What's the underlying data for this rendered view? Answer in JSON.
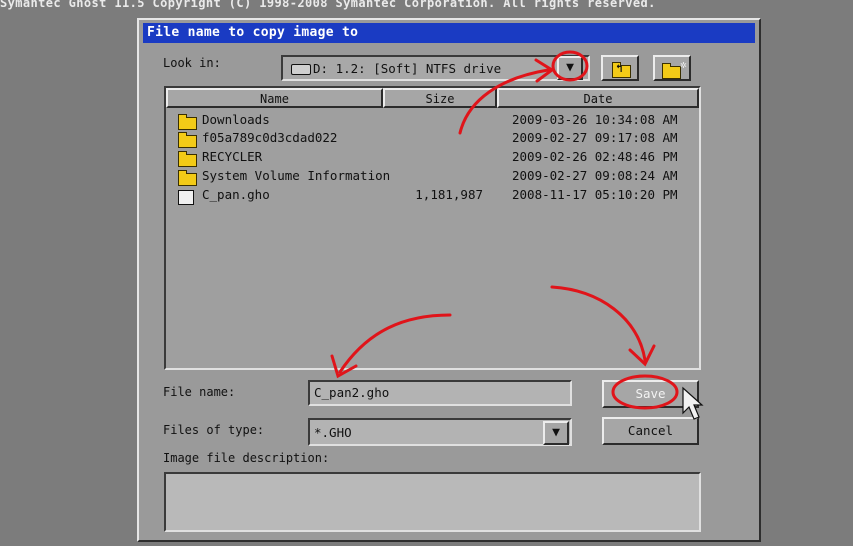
{
  "screen": {
    "top_banner": "Symantec Ghost 11.5   Copyright (C) 1998-2008 Symantec Corporation. All rights reserved."
  },
  "dialog": {
    "title": "File name to copy image to",
    "look_in_label": "Look in:",
    "look_in_value": "D: 1.2: [Soft] NTFS drive",
    "dropdown_glyph": "▼",
    "file_list": {
      "columns": [
        "Name",
        "Size",
        "Date"
      ],
      "rows": [
        {
          "type": "folder",
          "name": "Downloads",
          "size": "",
          "date": "2009-03-26 10:34:08 AM"
        },
        {
          "type": "folder",
          "name": "f05a789c0d3cdad022",
          "size": "",
          "date": "2009-02-27 09:17:08 AM"
        },
        {
          "type": "folder",
          "name": "RECYCLER",
          "size": "",
          "date": "2009-02-26 02:48:46 PM"
        },
        {
          "type": "folder",
          "name": "System Volume Information",
          "size": "",
          "date": "2009-02-27 09:08:24 AM"
        },
        {
          "type": "file",
          "name": "C_pan.gho",
          "size": "1,181,987",
          "date": "2008-11-17 05:10:20 PM"
        }
      ]
    },
    "file_name_label": "File name:",
    "file_name_value": "C_pan2.gho",
    "files_of_type_label": "Files of type:",
    "files_of_type_value": "*.GHO",
    "image_desc_label": "Image file description:",
    "image_desc_value": "",
    "save_button": "Save",
    "cancel_button": "Cancel"
  },
  "colors": {
    "title_bar": "#1a3bc3",
    "dialog_bg": "#9a9a9a",
    "annotation": "#e0141a",
    "folder": "#f3cb17"
  },
  "icons": {
    "drive": "hard-drive-icon",
    "up_folder": "up-folder-icon",
    "new_folder": "new-folder-icon",
    "folder": "folder-icon",
    "file": "ghost-image-file-icon"
  }
}
